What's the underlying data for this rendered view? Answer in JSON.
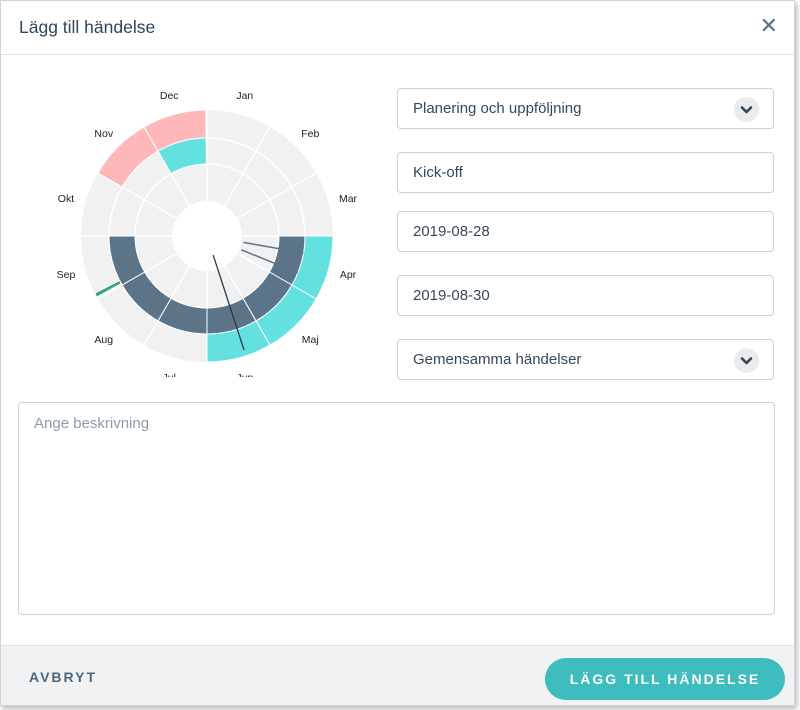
{
  "dialog": {
    "title": "Lägg till händelse",
    "close_icon": "close-icon"
  },
  "wheel": {
    "months": [
      "Jan",
      "Feb",
      "Mar",
      "Apr",
      "Maj",
      "Jun",
      "Jul",
      "Aug",
      "Sep",
      "Okt",
      "Nov",
      "Dec"
    ],
    "colors": {
      "empty": "#f1f1f1",
      "pink": "#ffb8ba",
      "turquoise": "#63e0e0",
      "navy": "#5c7488",
      "green": "#3aa57c",
      "hand": "#2e3a46"
    }
  },
  "form": {
    "category_value": "Planering och uppföljning",
    "name_value": "Kick-off",
    "start_date_value": "2019-08-28",
    "end_date_value": "2019-08-30",
    "calendar_value": "Gemensamma händelser",
    "description_placeholder": "Ange beskrivning"
  },
  "footer": {
    "cancel_label": "AVBRYT",
    "submit_label": "LÄGG TILL HÄNDELSE"
  }
}
